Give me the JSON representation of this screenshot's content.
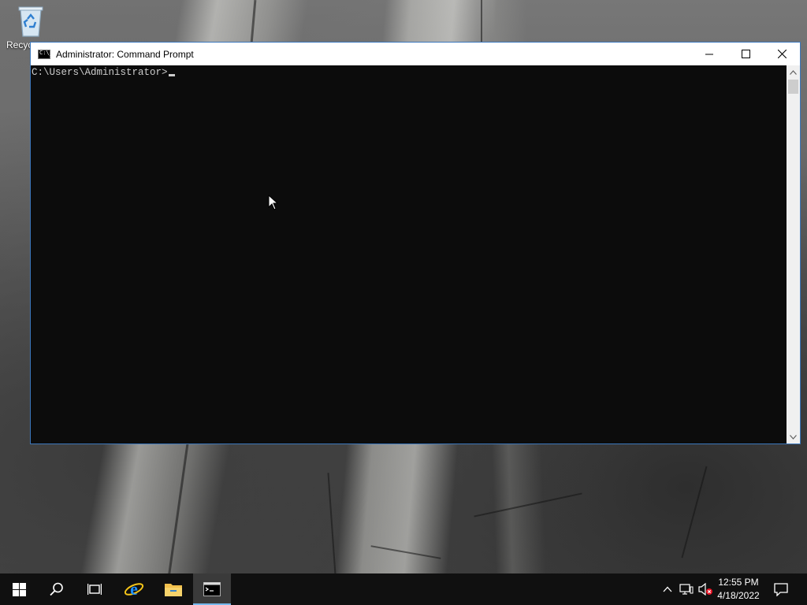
{
  "desktop": {
    "recycle_bin_label": "Recyc"
  },
  "window": {
    "title": "Administrator: Command Prompt",
    "icon_text": "C:\\_",
    "minimize": "minimize-icon",
    "maximize": "maximize-icon",
    "close": "close-icon"
  },
  "console": {
    "prompt": "C:\\Users\\Administrator>"
  },
  "taskbar": {
    "items": [
      "start-icon",
      "search-icon",
      "task-view-icon",
      "internet-explorer-icon",
      "file-explorer-icon",
      "command-prompt-icon"
    ],
    "active_item": "command-prompt-icon",
    "tray_icons": [
      "chevron-up-icon",
      "network-icon",
      "volume-muted-icon"
    ],
    "time": "12:55 PM",
    "date": "4/18/2022",
    "notifications_icon": "action-center-icon"
  },
  "colors": {
    "console_bg": "#0c0c0c",
    "console_text": "#cccccc",
    "taskbar_bg": "#101010",
    "active_indicator": "#76b9ed"
  }
}
